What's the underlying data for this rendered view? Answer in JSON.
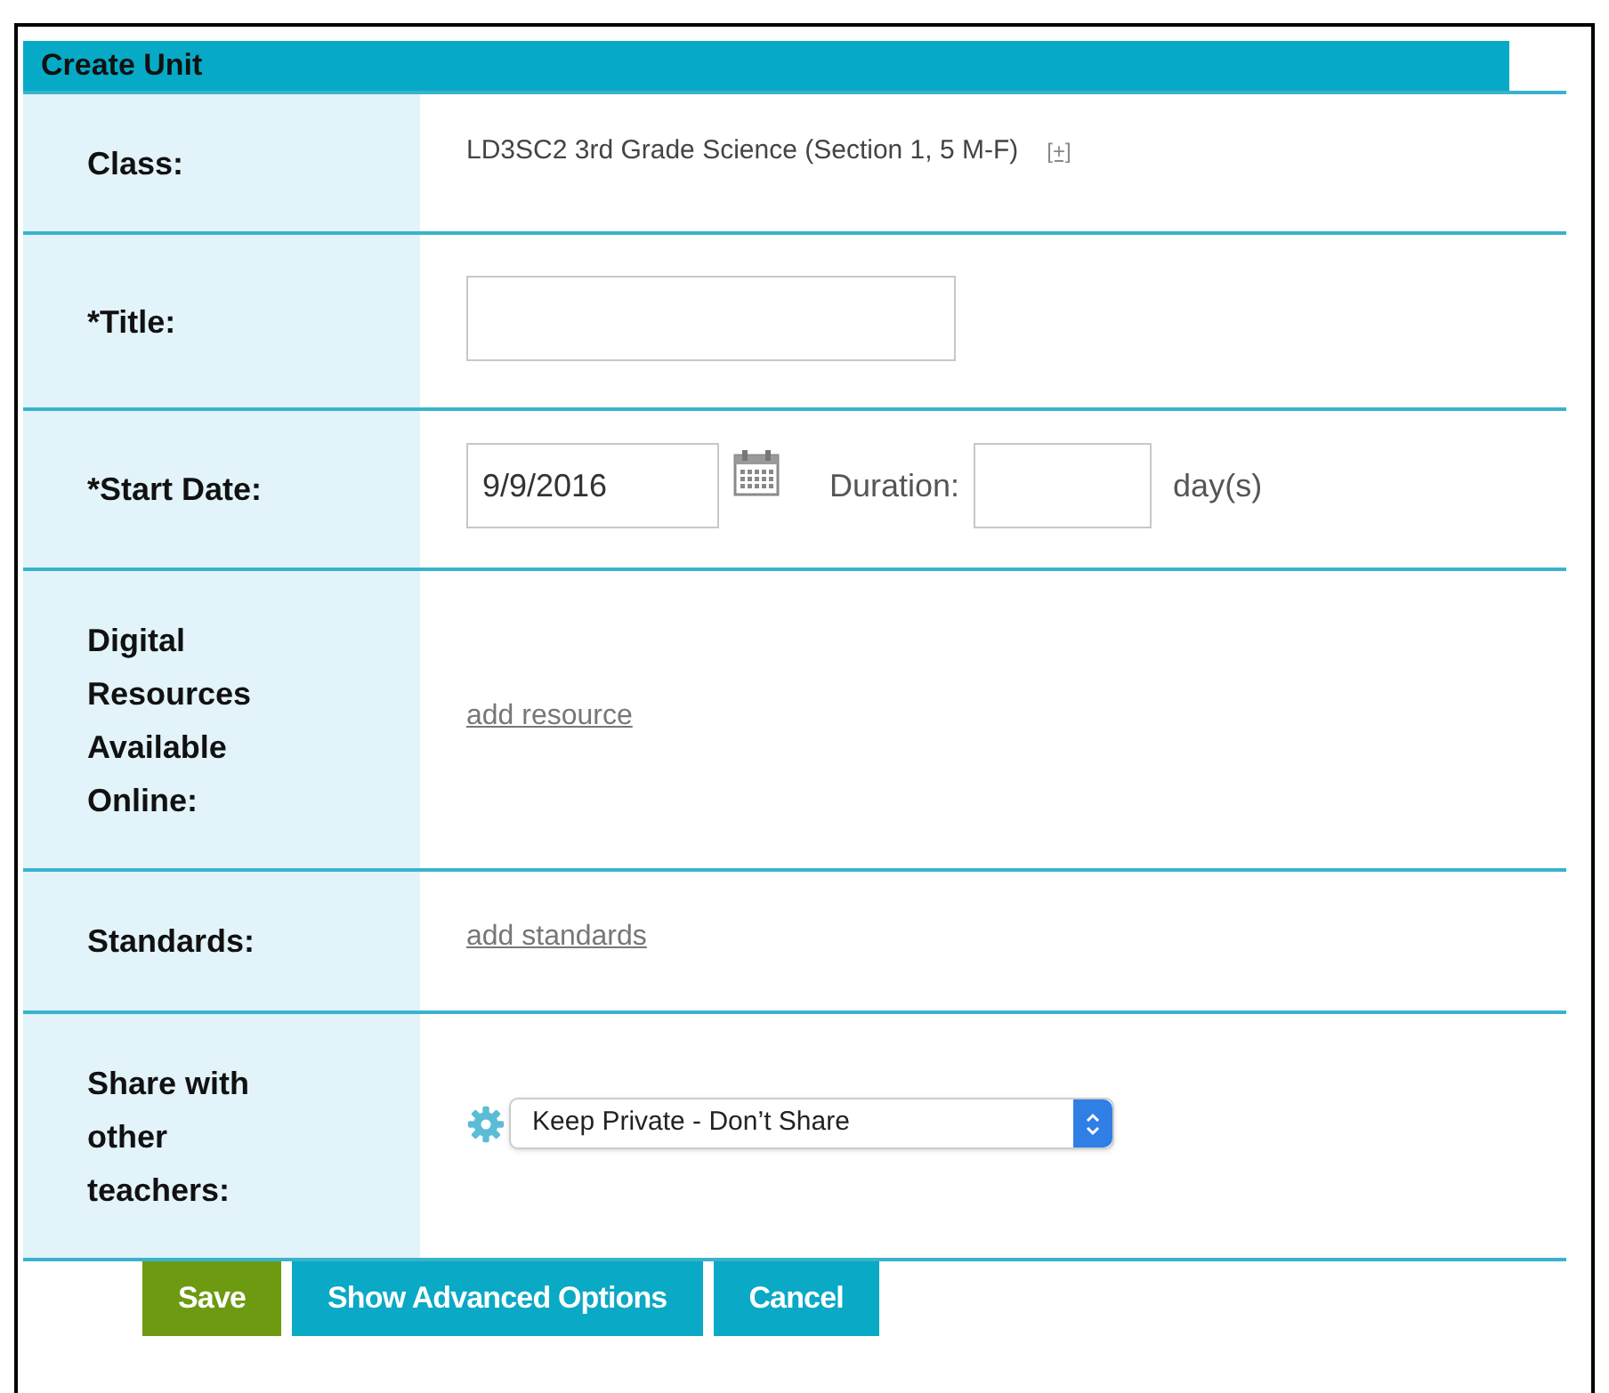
{
  "form": {
    "title": "Create Unit",
    "rows": [
      {
        "kind": "text",
        "label": "Class:",
        "value": "LD3SC2 3rd Grade Science (Section 1, 5 M-F)",
        "extra": "[+]"
      },
      {
        "kind": "input",
        "label": "*Title:"
      },
      {
        "kind": "date",
        "label": "*Start Date:",
        "value": "9/9/2016",
        "duration_label": "Duration:",
        "unit": "day(s)"
      },
      {
        "kind": "link",
        "label": "Digital Resources Available Online:",
        "value": "add resource"
      },
      {
        "kind": "link",
        "label": "Standards:",
        "value": "add standards"
      },
      {
        "kind": "select",
        "label": "Share with other teachers:",
        "value": "Keep Private - Don’t Share"
      }
    ]
  },
  "buttons": [
    {
      "kind": "primary",
      "label": "Save"
    },
    {
      "kind": "secondary",
      "label": "Show Advanced Options"
    },
    {
      "kind": "secondary",
      "label": "Cancel"
    }
  ]
}
